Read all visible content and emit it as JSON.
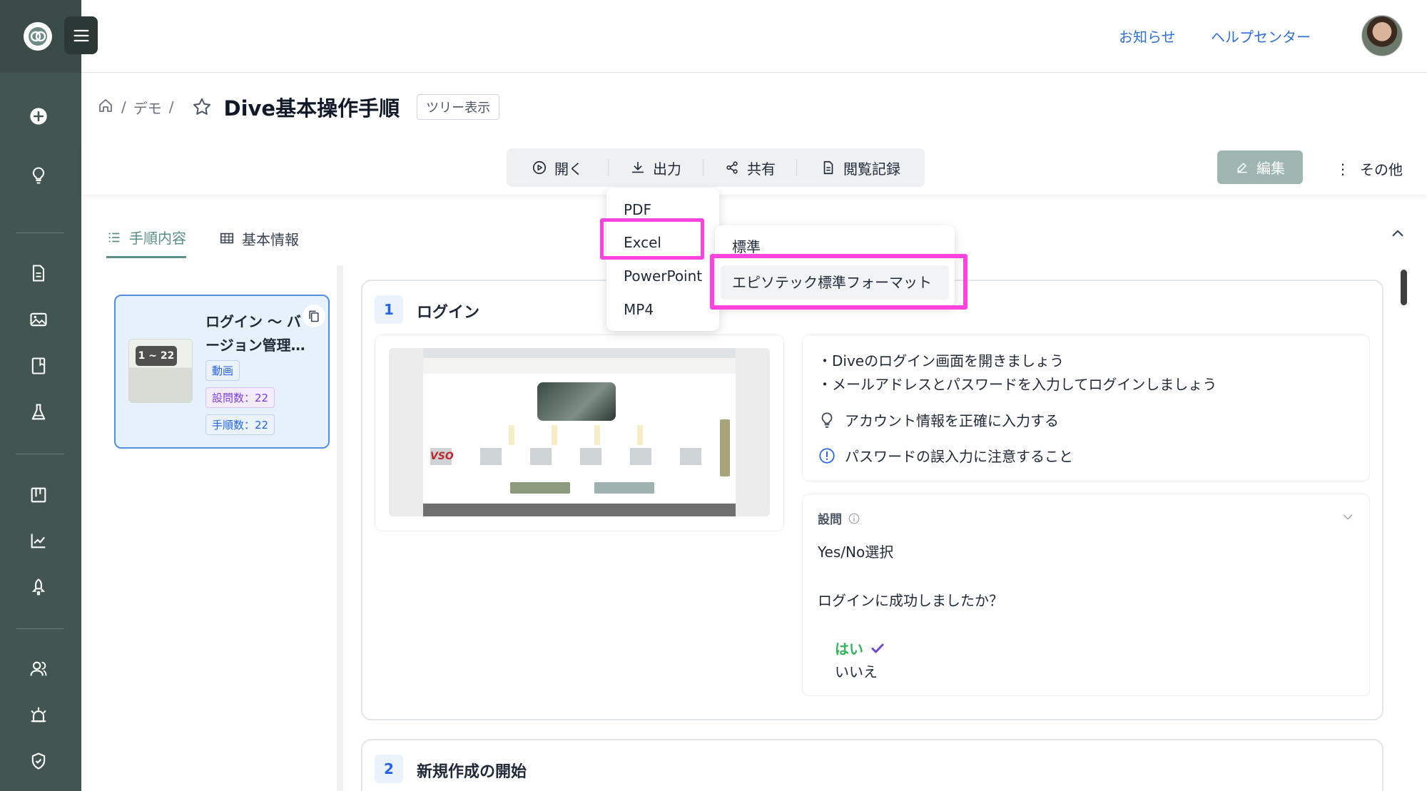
{
  "header": {
    "links": [
      "お知らせ",
      "ヘルプセンター"
    ]
  },
  "breadcrumb": {
    "path": [
      "デモ"
    ],
    "title": "Dive基本操作手順",
    "tree_button": "ツリー表示"
  },
  "toolbar": {
    "items": [
      {
        "label": "開く",
        "icon": "play-circle-icon"
      },
      {
        "label": "出力",
        "icon": "download-icon"
      },
      {
        "label": "共有",
        "icon": "share-icon"
      },
      {
        "label": "閲覧記録",
        "icon": "document-icon"
      }
    ],
    "edit_label": "編集",
    "more_label": "その他"
  },
  "tabs": [
    {
      "label": "手順内容",
      "active": true
    },
    {
      "label": "基本情報",
      "active": false
    }
  ],
  "list": {
    "card": {
      "badge": "1 ~ 22",
      "title": "ログイン ～ バージョン管理…",
      "tag_video": "動画",
      "question_count": "設問数：22",
      "step_count": "手順数：22"
    }
  },
  "steps": [
    {
      "number": "1",
      "title": "ログイン",
      "screenshot_text": "VSO",
      "description": [
        "・Diveのログイン画面を開きましょう",
        "・メールアドレスとパスワードを入力してログインしましょう"
      ],
      "tips": [
        {
          "icon": "lightbulb-icon",
          "text": "アカウント情報を正確に入力する"
        },
        {
          "icon": "info-icon",
          "text": "パスワードの誤入力に注意すること"
        }
      ],
      "question": {
        "label": "設問",
        "type": "Yes/No選択",
        "text": "ログインに成功しましたか？",
        "answers": [
          "はい",
          "いいえ"
        ],
        "correct": "はい"
      }
    },
    {
      "number": "2",
      "title": "新規作成の開始"
    }
  ],
  "export_menu": {
    "items": [
      "PDF",
      "Excel",
      "PowerPoint",
      "MP4"
    ],
    "highlighted": "Excel",
    "submenu": [
      "標準",
      "エピソテック標準フォーマット"
    ],
    "submenu_highlighted": "エピソテック標準フォーマット"
  },
  "colors": {
    "sidebar": "#435550",
    "accent": "#5b8f86",
    "link": "#2f6fdb",
    "highlight": "#ff44dd",
    "edit_button": "#9fb5b0",
    "answer_yes": "#34b45a"
  }
}
